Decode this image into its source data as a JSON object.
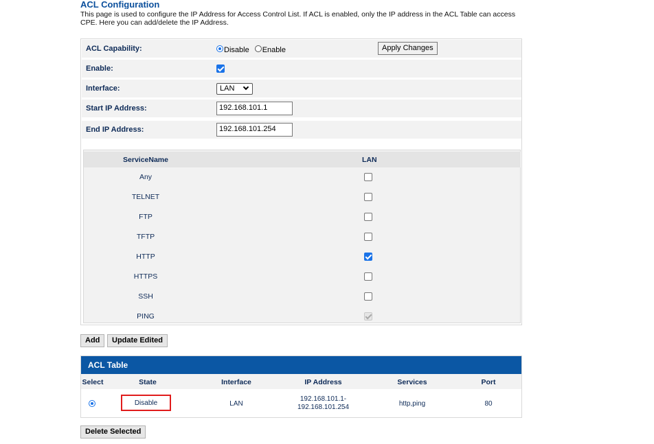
{
  "header": {
    "title": "ACL Configuration",
    "description": "This page is used to configure the IP Address for Access Control List. If ACL is enabled, only the IP address in the ACL Table can access CPE. Here you can add/delete the IP Address."
  },
  "form": {
    "capability_label": "ACL Capability:",
    "capability_options": [
      "Disable",
      "Enable"
    ],
    "capability_selected": "Disable",
    "apply_label": "Apply Changes",
    "enable_label": "Enable:",
    "enable_checked": true,
    "interface_label": "Interface:",
    "interface_value": "LAN",
    "start_ip_label": "Start IP Address:",
    "start_ip_value": "192.168.101.1",
    "end_ip_label": "End IP Address:",
    "end_ip_value": "192.168.101.254"
  },
  "services": {
    "col_name": "ServiceName",
    "col_lan": "LAN",
    "rows": [
      {
        "name": "Any",
        "state": "unchecked"
      },
      {
        "name": "TELNET",
        "state": "unchecked"
      },
      {
        "name": "FTP",
        "state": "unchecked"
      },
      {
        "name": "TFTP",
        "state": "unchecked"
      },
      {
        "name": "HTTP",
        "state": "checked"
      },
      {
        "name": "HTTPS",
        "state": "unchecked"
      },
      {
        "name": "SSH",
        "state": "unchecked"
      },
      {
        "name": "PING",
        "state": "disabled-checked"
      }
    ]
  },
  "actions": {
    "add_label": "Add",
    "update_label": "Update Edited",
    "delete_label": "Delete Selected"
  },
  "acl_table": {
    "title": "ACL Table",
    "columns": [
      "Select",
      "State",
      "Interface",
      "IP Address",
      "Services",
      "Port"
    ],
    "row": {
      "selected": true,
      "state": "Disable",
      "interface": "LAN",
      "ip_line1": "192.168.101.1-",
      "ip_line2": "192.168.101.254",
      "services": "http,ping",
      "port": "80"
    }
  },
  "colors": {
    "title_blue": "#0b4f9c",
    "table_bar": "#0b57a4",
    "highlight_red": "#e01b1b",
    "check_blue": "#1a73e8"
  }
}
